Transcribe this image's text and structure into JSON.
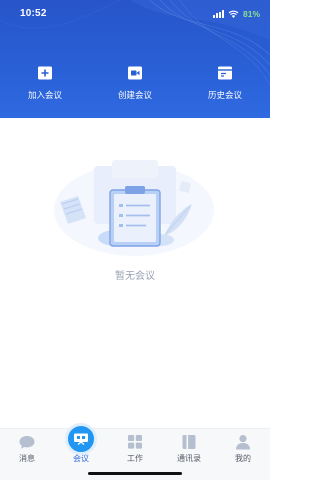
{
  "status_bar": {
    "time": "10:52",
    "battery": "81%"
  },
  "actions": [
    {
      "label": "加入会议",
      "icon": "add-square-icon"
    },
    {
      "label": "创建会议",
      "icon": "video-camera-icon"
    },
    {
      "label": "历史会议",
      "icon": "history-card-icon"
    }
  ],
  "empty_state": {
    "text": "暂无会议",
    "illustration": "clipboard-illustration-icon"
  },
  "tabbar": {
    "items": [
      {
        "label": "消息",
        "icon": "chat-bubble-icon",
        "active": false
      },
      {
        "label": "会议",
        "icon": "meeting-icon",
        "active": true
      },
      {
        "label": "工作",
        "icon": "grid-icon",
        "active": false
      },
      {
        "label": "通讯录",
        "icon": "contacts-book-icon",
        "active": false
      },
      {
        "label": "我的",
        "icon": "person-icon",
        "active": false
      }
    ]
  },
  "colors": {
    "header": "#2a5fd6",
    "accent": "#2196f3",
    "muted_text": "#9aa3b5"
  }
}
